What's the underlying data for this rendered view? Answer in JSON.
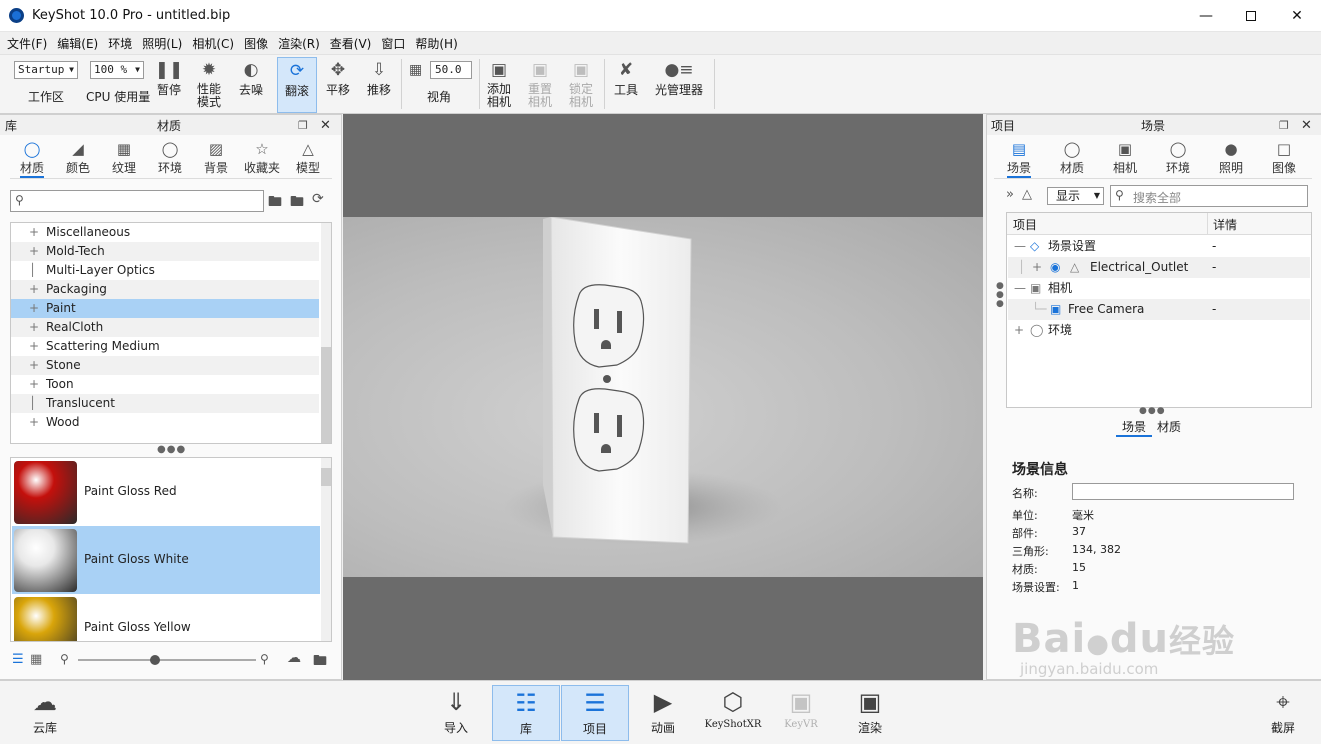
{
  "window": {
    "title": "KeyShot 10.0 Pro  - untitled.bip",
    "minimize_icon": "minimize-icon",
    "maximize_icon": "maximize-icon",
    "close_icon": "close-icon"
  },
  "menu": [
    "文件(F)",
    "编辑(E)",
    "环境",
    "照明(L)",
    "相机(C)",
    "图像",
    "渲染(R)",
    "查看(V)",
    "窗口",
    "帮助(H)"
  ],
  "toolbar": {
    "workspace_value": "Startup",
    "workspace_label": "工作区",
    "cpu_value": "100 %",
    "cpu_label": "CPU 使用量",
    "pause": "暂停",
    "perf_mode_1": "性能",
    "perf_mode_2": "模式",
    "denoise": "去噪",
    "tumble": "翻滚",
    "pan": "平移",
    "dolly": "推移",
    "fov_value": "50.0",
    "fov_label": "视角",
    "add_camera_1": "添加",
    "add_camera_2": "相机",
    "reset_camera_1": "重置",
    "reset_camera_2": "相机",
    "lock_camera_1": "锁定",
    "lock_camera_2": "相机",
    "tools": "工具",
    "light_manager": "光管理器"
  },
  "library": {
    "header_left": "库",
    "header_title": "材质",
    "tabs": [
      "材质",
      "颜色",
      "纹理",
      "环境",
      "背景",
      "收藏夹",
      "模型"
    ],
    "search_placeholder": "",
    "tree": [
      {
        "label": "Miscellaneous",
        "expandable": true
      },
      {
        "label": "Mold-Tech",
        "expandable": true
      },
      {
        "label": "Multi-Layer Optics",
        "expandable": false
      },
      {
        "label": "Packaging",
        "expandable": true
      },
      {
        "label": "Paint",
        "expandable": true,
        "selected": true
      },
      {
        "label": "RealCloth",
        "expandable": true
      },
      {
        "label": "Scattering Medium",
        "expandable": true
      },
      {
        "label": "Stone",
        "expandable": true
      },
      {
        "label": "Toon",
        "expandable": true
      },
      {
        "label": "Translucent",
        "expandable": false
      },
      {
        "label": "Wood",
        "expandable": true
      }
    ],
    "materials": [
      {
        "name": "Paint Gloss Red",
        "color": "#c4100c"
      },
      {
        "name": "Paint Gloss White",
        "color": "#e8e8e8",
        "selected": true
      },
      {
        "name": "Paint Gloss Yellow",
        "color": "#d9a50a"
      }
    ]
  },
  "project": {
    "header_left": "项目",
    "header_title": "场景",
    "tabs": [
      "场景",
      "材质",
      "相机",
      "环境",
      "照明",
      "图像"
    ],
    "display_value": "显示",
    "search_placeholder": "搜索全部",
    "col_item": "项目",
    "col_detail": "详情",
    "tree": [
      {
        "label": "场景设置",
        "detail": "-"
      },
      {
        "label": "Electrical_Outlet",
        "detail": "-"
      },
      {
        "label": "相机",
        "detail": ""
      },
      {
        "label": "Free Camera",
        "detail": "-"
      },
      {
        "label": "环境",
        "detail": ""
      }
    ],
    "subtabs": [
      "场景",
      "材质"
    ],
    "info_title": "场景信息",
    "info": {
      "name_label": "名称:",
      "name_value": "",
      "unit_label": "单位:",
      "unit_value": "毫米",
      "parts_label": "部件:",
      "parts_value": "37",
      "triangles_label": "三角形:",
      "triangles_value": "134, 382",
      "materials_label": "材质:",
      "materials_value": "15",
      "scene_sets_label": "场景设置:",
      "scene_sets_value": "1"
    }
  },
  "bottom": {
    "cloud": "云库",
    "import": "导入",
    "library": "库",
    "project": "项目",
    "animation": "动画",
    "keyshotxr": "KeyShotXR",
    "keyvr": "KeyVR",
    "render": "渲染",
    "screenshot": "截屏"
  },
  "watermark": {
    "brand": "Bai",
    "brand2": "du",
    "brand3": "经验",
    "url": "jingyan.baidu.com"
  }
}
